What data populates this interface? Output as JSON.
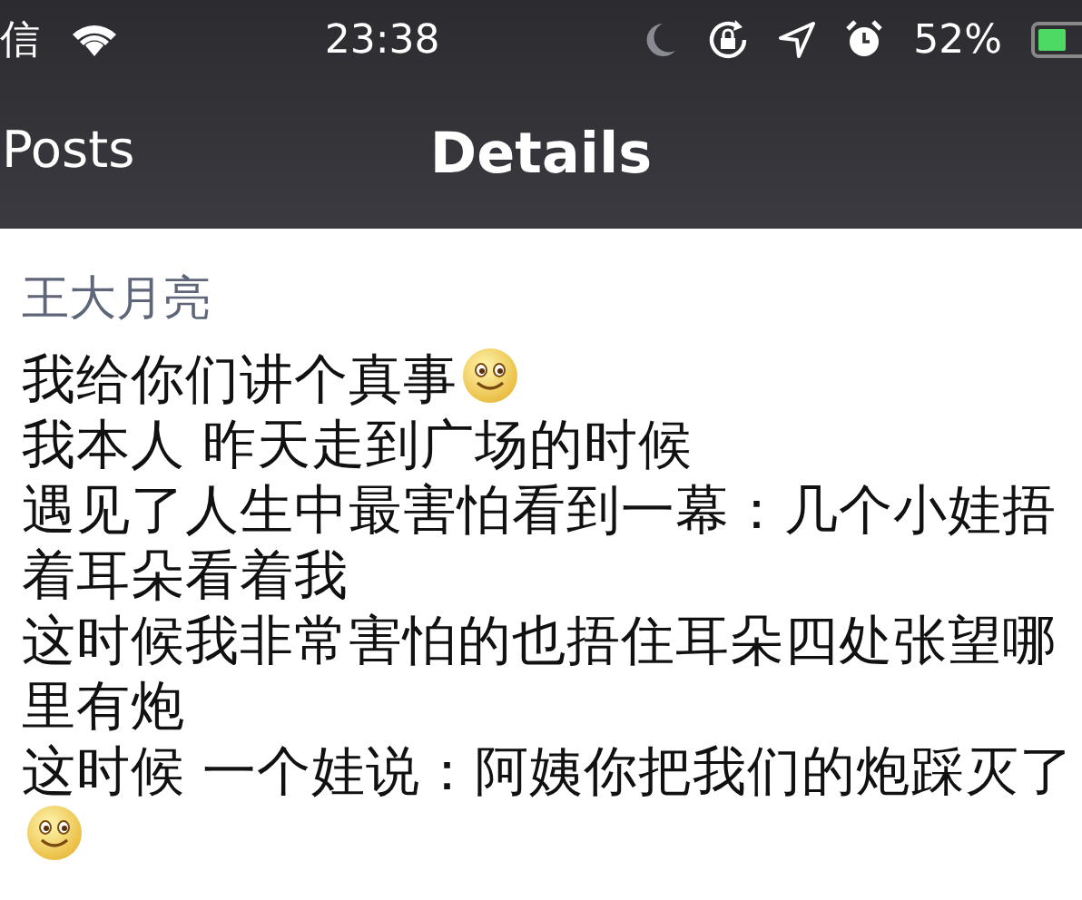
{
  "status_bar": {
    "carrier": "信",
    "time": "23:38",
    "battery_text": "52%"
  },
  "nav": {
    "back_label": "Posts",
    "title": "Details"
  },
  "post": {
    "author": "王大月亮",
    "lines": [
      {
        "text": "我给你们讲个真事",
        "emoji_after": true
      },
      {
        "text": "我本人 昨天走到广场的时候",
        "emoji_after": false
      },
      {
        "text": "遇见了人生中最害怕看到一幕：几个小娃捂着耳朵看着我",
        "emoji_after": false
      },
      {
        "text": "这时候我非常害怕的也捂住耳朵四处张望哪里有炮",
        "emoji_after": false
      },
      {
        "text": "这时候 一个娃说：阿姨你把我们的炮踩灭了",
        "emoji_after": true
      }
    ]
  }
}
